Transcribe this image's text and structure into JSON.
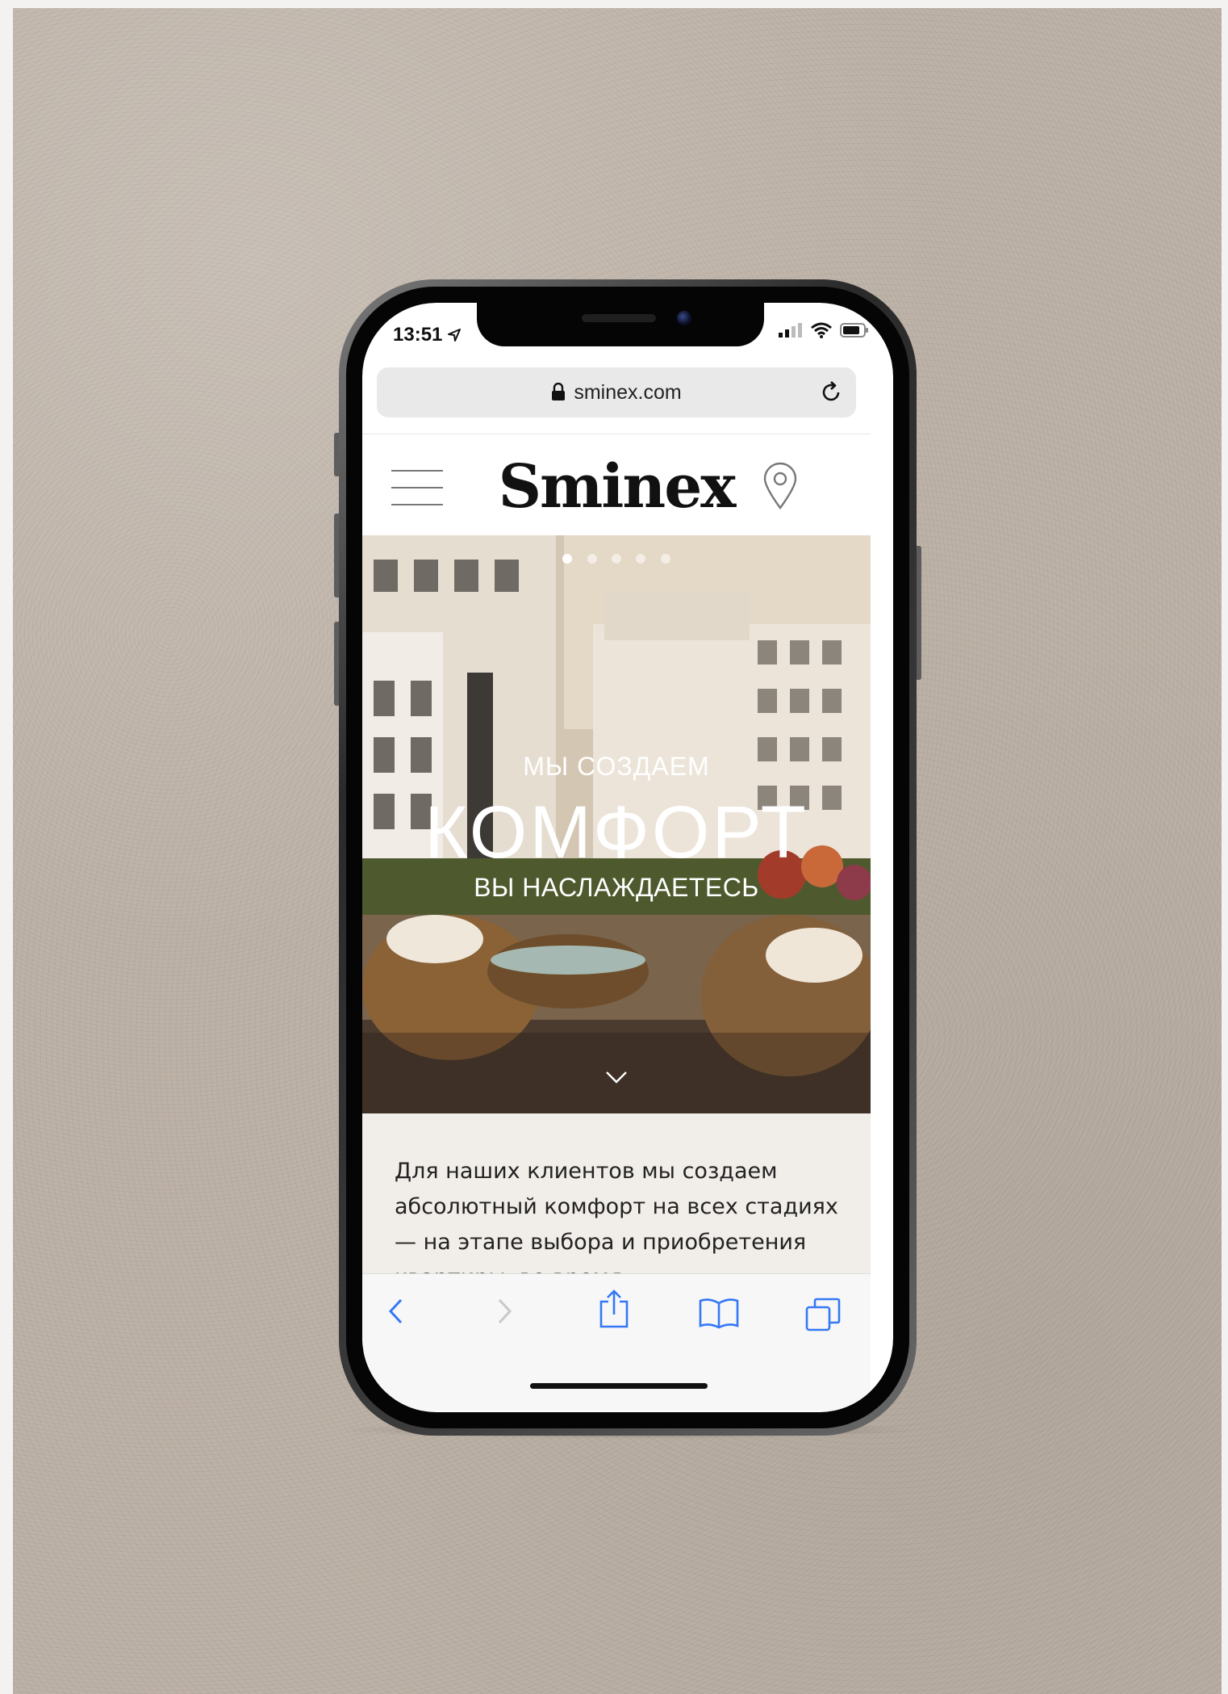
{
  "status_bar": {
    "time": "13:51",
    "location_arrow_icon": "location-arrow-icon",
    "signal_icon": "cellular-signal-icon",
    "wifi_icon": "wifi-icon",
    "battery_icon": "battery-icon"
  },
  "browser": {
    "url": "sminex.com",
    "lock_icon": "lock-icon",
    "reload_icon": "reload-icon"
  },
  "site_header": {
    "logo": "Sminex",
    "menu_icon": "hamburger-menu-icon",
    "location_icon": "map-pin-icon"
  },
  "hero": {
    "kicker": "МЫ СОЗДАЕМ",
    "title": "КОМФОРТ",
    "subtitle": "ВЫ НАСЛАЖДАЕТЕСЬ",
    "slides_total": 5,
    "active_slide": 1,
    "scroll_icon": "chevron-down-icon"
  },
  "content": {
    "paragraph": "Для наших клиентов мы создаем абсолютный комфорт на всех стадиях — на этапе выбора и приобретения квартиры, во время"
  },
  "toolbar": {
    "back_icon": "back-arrow-icon",
    "forward_icon": "forward-arrow-icon",
    "share_icon": "share-icon",
    "bookmarks_icon": "bookmarks-icon",
    "tabs_icon": "tabs-icon"
  },
  "colors": {
    "accent_ios": "#3478f6",
    "background_stone": "#bdb2a7",
    "text_dark": "#111111"
  }
}
